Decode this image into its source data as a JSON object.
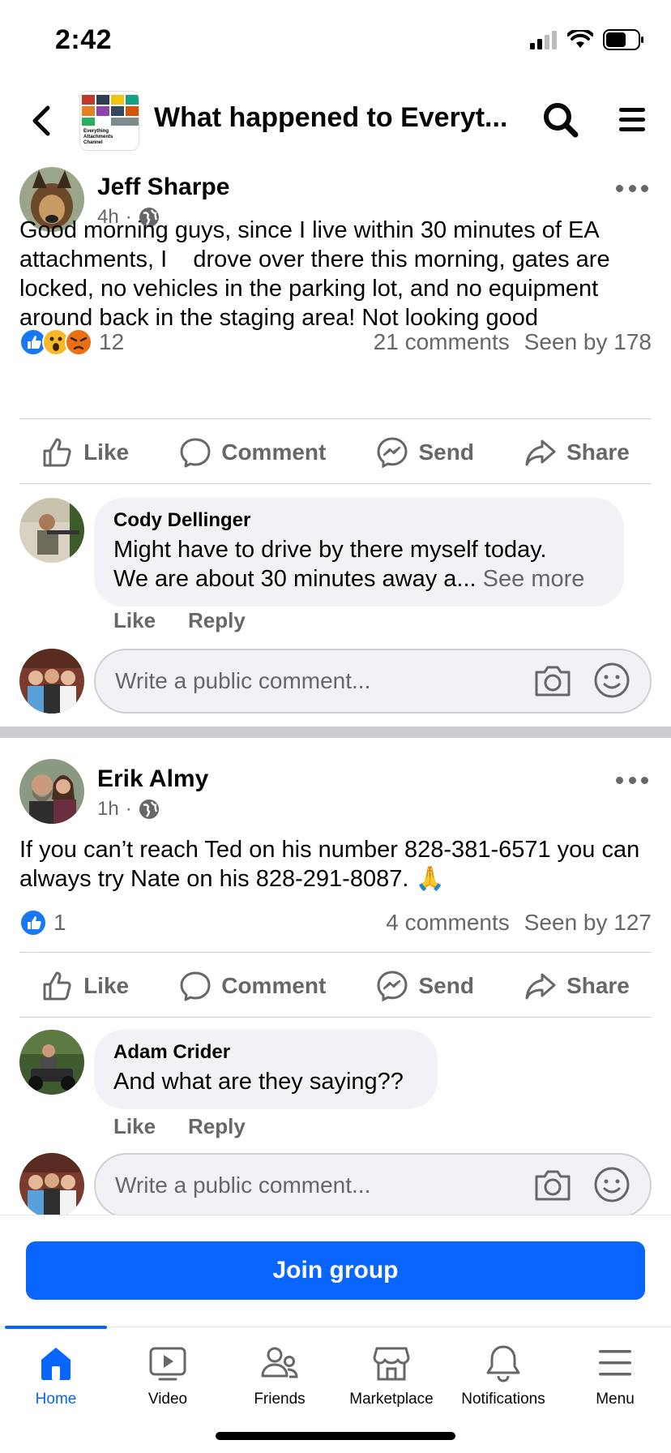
{
  "status_bar": {
    "time": "2:42"
  },
  "header": {
    "title": "What happened to Everyt...",
    "thumb_text": "Everything Attachments Channel"
  },
  "posts": [
    {
      "author": "Jeff Sharpe",
      "time": "4h",
      "text": "Good morning guys, since I live within 30 minutes of EA attachments, I    drove over there this morning, gates are locked, no vehicles in the parking lot, and no equipment around back in the staging area! Not looking good",
      "reaction_count": "12",
      "comments_count": "21 comments",
      "seen_by": "Seen by 178",
      "actions": {
        "like": "Like",
        "comment": "Comment",
        "send": "Send",
        "share": "Share"
      },
      "comment": {
        "author": "Cody Dellinger",
        "text_line1": "Might have to drive by there myself today.",
        "text_line2": "We are about 30 minutes away a...",
        "see_more": "See more",
        "like": "Like",
        "reply": "Reply"
      },
      "write_placeholder": "Write a public comment..."
    },
    {
      "author": "Erik Almy",
      "time": "1h",
      "text": "If you can’t reach Ted on his number 828-381-6571 you can always try Nate on his 828-291-8087. 🙏",
      "reaction_count": "1",
      "comments_count": "4 comments",
      "seen_by": "Seen by 127",
      "actions": {
        "like": "Like",
        "comment": "Comment",
        "send": "Send",
        "share": "Share"
      },
      "comment": {
        "author": "Adam Crider",
        "text": "And what are they saying??",
        "like": "Like",
        "reply": "Reply"
      },
      "write_placeholder": "Write a public comment..."
    }
  ],
  "join_button": "Join group",
  "tabs": [
    {
      "label": "Home",
      "icon": "home-icon",
      "active": true
    },
    {
      "label": "Video",
      "icon": "video-icon",
      "active": false
    },
    {
      "label": "Friends",
      "icon": "friends-icon",
      "active": false
    },
    {
      "label": "Marketplace",
      "icon": "marketplace-icon",
      "active": false
    },
    {
      "label": "Notifications",
      "icon": "bell-icon",
      "active": false
    },
    {
      "label": "Menu",
      "icon": "menu-icon",
      "active": false
    }
  ],
  "colors": {
    "accent": "#0866ff",
    "secondary_text": "#65676b",
    "bubble": "#f0f2f5"
  }
}
